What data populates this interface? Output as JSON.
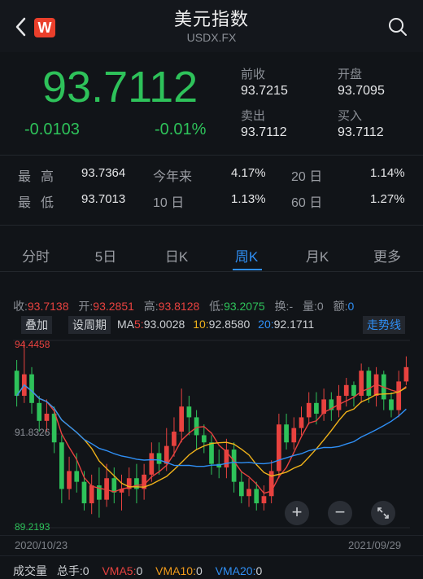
{
  "header": {
    "title": "美元指数",
    "subtitle": "USDX.FX",
    "logo_text": "W",
    "icons": [
      "back-arrow-icon",
      "search-icon"
    ]
  },
  "quote": {
    "price": "93.7112",
    "change": "-0.0103",
    "change_pct": "-0.01%",
    "prev_close_label": "前收",
    "prev_close": "93.7215",
    "open_label": "开盘",
    "open": "93.7095",
    "sell_label": "卖出",
    "sell": "93.7112",
    "buy_label": "买入",
    "buy": "93.7112"
  },
  "stats": {
    "high_label": "最高",
    "high": "93.7364",
    "low_label": "最低",
    "low": "93.7013",
    "ytd_label": "今年来",
    "ytd": "4.17%",
    "d10_label": "10 日",
    "d10": "1.13%",
    "d20_label": "20 日",
    "d20": "1.14%",
    "d60_label": "60 日",
    "d60": "1.27%"
  },
  "tabs": [
    "分时",
    "5日",
    "日K",
    "周K",
    "月K",
    "更多"
  ],
  "active_tab": "周K",
  "ohlc": {
    "close_label": "收:",
    "close": "93.7138",
    "open_label": "开:",
    "open": "93.2851",
    "high_label": "高:",
    "high": "93.8128",
    "low_label": "低:",
    "low": "93.2075",
    "turnover_label": "换:",
    "turnover": "-",
    "volume_label": "量:",
    "volume": "0",
    "amount_label": "额:",
    "amount": "0"
  },
  "controls": {
    "overlay": "叠加",
    "set_period": "设周期",
    "trend": "走势线"
  },
  "ma": {
    "label": "MA",
    "ma5_label": "5:",
    "ma5": "93.0028",
    "ma10_label": "10:",
    "ma10": "92.8580",
    "ma20_label": "20:",
    "ma20": "92.1711"
  },
  "axis": {
    "top": "94.4458",
    "mid": "91.8326",
    "bottom": "89.2193",
    "start_date": "2020/10/23",
    "end_date": "2021/09/29"
  },
  "volume": {
    "label": "成交量",
    "total_label": "总手:",
    "total": "0",
    "vma5_label": "VMA5:",
    "vma5": "0",
    "vma10_label": "VMA10:",
    "vma10": "0",
    "vma20_label": "VMA20:",
    "vma20": "0"
  },
  "colors": {
    "up": "#e8423f",
    "down": "#2ec25a",
    "accent": "#2f8ff5",
    "ma5": "#e8423f",
    "ma10": "#f0b21a",
    "ma20": "#2f8ff5"
  },
  "chart_data": {
    "type": "candlestick",
    "ylim": [
      89.2193,
      94.4458
    ],
    "candles": [
      {
        "o": 93.6,
        "c": 92.9,
        "h": 93.9,
        "l": 92.6
      },
      {
        "o": 92.9,
        "c": 93.5,
        "h": 94.4,
        "l": 92.7
      },
      {
        "o": 93.5,
        "c": 92.7,
        "h": 93.7,
        "l": 92.4
      },
      {
        "o": 92.7,
        "c": 92.2,
        "h": 92.9,
        "l": 91.9
      },
      {
        "o": 92.2,
        "c": 92.4,
        "h": 92.8,
        "l": 91.9
      },
      {
        "o": 92.4,
        "c": 91.6,
        "h": 92.6,
        "l": 91.3
      },
      {
        "o": 91.6,
        "c": 90.3,
        "h": 91.8,
        "l": 89.9
      },
      {
        "o": 90.3,
        "c": 90.8,
        "h": 91.2,
        "l": 90.0
      },
      {
        "o": 90.8,
        "c": 90.5,
        "h": 91.3,
        "l": 90.2
      },
      {
        "o": 90.5,
        "c": 89.9,
        "h": 90.8,
        "l": 89.7
      },
      {
        "o": 89.9,
        "c": 90.4,
        "h": 90.7,
        "l": 89.6
      },
      {
        "o": 90.4,
        "c": 90.0,
        "h": 90.9,
        "l": 89.5
      },
      {
        "o": 90.0,
        "c": 90.6,
        "h": 91.0,
        "l": 89.8
      },
      {
        "o": 90.6,
        "c": 90.2,
        "h": 90.9,
        "l": 89.9
      },
      {
        "o": 90.2,
        "c": 90.3,
        "h": 90.7,
        "l": 89.7
      },
      {
        "o": 90.3,
        "c": 90.6,
        "h": 90.9,
        "l": 90.1
      },
      {
        "o": 90.6,
        "c": 90.3,
        "h": 91.0,
        "l": 89.9
      },
      {
        "o": 90.3,
        "c": 90.7,
        "h": 91.0,
        "l": 90.0
      },
      {
        "o": 90.7,
        "c": 91.3,
        "h": 91.6,
        "l": 90.5
      },
      {
        "o": 91.3,
        "c": 91.0,
        "h": 91.6,
        "l": 90.7
      },
      {
        "o": 91.0,
        "c": 91.5,
        "h": 92.0,
        "l": 90.8
      },
      {
        "o": 91.5,
        "c": 91.9,
        "h": 92.3,
        "l": 91.2
      },
      {
        "o": 91.9,
        "c": 92.6,
        "h": 93.1,
        "l": 91.6
      },
      {
        "o": 92.6,
        "c": 92.3,
        "h": 92.9,
        "l": 91.8
      },
      {
        "o": 92.3,
        "c": 91.8,
        "h": 92.5,
        "l": 91.4
      },
      {
        "o": 91.8,
        "c": 91.6,
        "h": 92.1,
        "l": 91.3
      },
      {
        "o": 91.6,
        "c": 91.0,
        "h": 91.8,
        "l": 90.7
      },
      {
        "o": 91.0,
        "c": 90.9,
        "h": 91.4,
        "l": 90.6
      },
      {
        "o": 90.9,
        "c": 91.4,
        "h": 91.7,
        "l": 90.6
      },
      {
        "o": 91.4,
        "c": 90.5,
        "h": 91.6,
        "l": 90.2
      },
      {
        "o": 90.5,
        "c": 90.1,
        "h": 90.8,
        "l": 89.9
      },
      {
        "o": 90.1,
        "c": 90.3,
        "h": 90.6,
        "l": 89.8
      },
      {
        "o": 90.3,
        "c": 89.9,
        "h": 90.5,
        "l": 89.7
      },
      {
        "o": 89.9,
        "c": 90.1,
        "h": 90.4,
        "l": 89.7
      },
      {
        "o": 90.1,
        "c": 90.8,
        "h": 91.1,
        "l": 89.9
      },
      {
        "o": 90.8,
        "c": 92.1,
        "h": 92.4,
        "l": 90.6
      },
      {
        "o": 92.1,
        "c": 91.6,
        "h": 92.4,
        "l": 91.4
      },
      {
        "o": 91.6,
        "c": 92.0,
        "h": 92.3,
        "l": 91.4
      },
      {
        "o": 92.0,
        "c": 92.3,
        "h": 92.6,
        "l": 91.8
      },
      {
        "o": 92.3,
        "c": 92.7,
        "h": 93.0,
        "l": 92.1
      },
      {
        "o": 92.7,
        "c": 92.4,
        "h": 93.0,
        "l": 92.1
      },
      {
        "o": 92.4,
        "c": 92.8,
        "h": 93.1,
        "l": 92.2
      },
      {
        "o": 92.8,
        "c": 92.5,
        "h": 93.0,
        "l": 92.2
      },
      {
        "o": 92.5,
        "c": 92.9,
        "h": 93.2,
        "l": 92.3
      },
      {
        "o": 92.9,
        "c": 93.2,
        "h": 93.4,
        "l": 92.6
      },
      {
        "o": 93.2,
        "c": 92.9,
        "h": 93.3,
        "l": 92.6
      },
      {
        "o": 92.9,
        "c": 93.6,
        "h": 93.8,
        "l": 92.7
      },
      {
        "o": 93.6,
        "c": 92.9,
        "h": 93.7,
        "l": 92.7
      },
      {
        "o": 92.9,
        "c": 93.5,
        "h": 93.7,
        "l": 92.6
      },
      {
        "o": 93.5,
        "c": 92.8,
        "h": 93.6,
        "l": 92.5
      },
      {
        "o": 92.8,
        "c": 92.5,
        "h": 93.0,
        "l": 92.3
      },
      {
        "o": 92.5,
        "c": 93.3,
        "h": 93.6,
        "l": 92.3
      },
      {
        "o": 93.3,
        "c": 93.7,
        "h": 94.0,
        "l": 93.2
      }
    ]
  }
}
